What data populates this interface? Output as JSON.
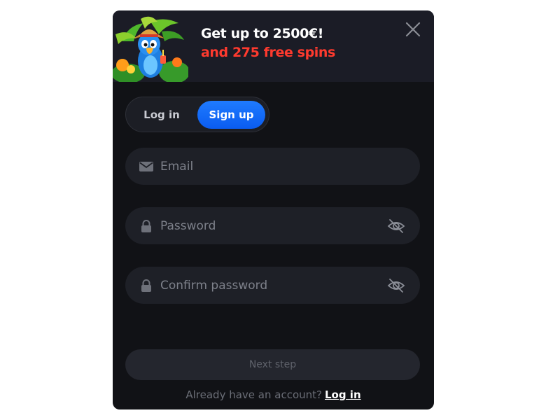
{
  "banner": {
    "line1": "Get up to 2500€!",
    "line2": "and 275 free spins",
    "mascot_icon": "parrot-mascot",
    "accent_color": "#ff3a2e"
  },
  "close_icon": "close-icon",
  "tabs": [
    {
      "label": "Log in",
      "active": false
    },
    {
      "label": "Sign up",
      "active": true
    }
  ],
  "form": {
    "email": {
      "placeholder": "Email",
      "value": "",
      "icon": "mail-icon"
    },
    "password": {
      "placeholder": "Password",
      "value": "",
      "icon": "lock-icon",
      "toggle_icon": "eye-off-icon"
    },
    "confirm_password": {
      "placeholder": "Confirm password",
      "value": "",
      "icon": "lock-icon",
      "toggle_icon": "eye-off-icon"
    }
  },
  "next_button": {
    "label": "Next step",
    "enabled": false
  },
  "footer": {
    "text": "Already have an account?",
    "link": "Log in"
  },
  "colors": {
    "primary": "#0a6bff",
    "background": "#111216",
    "banner": "#1b1c26"
  }
}
